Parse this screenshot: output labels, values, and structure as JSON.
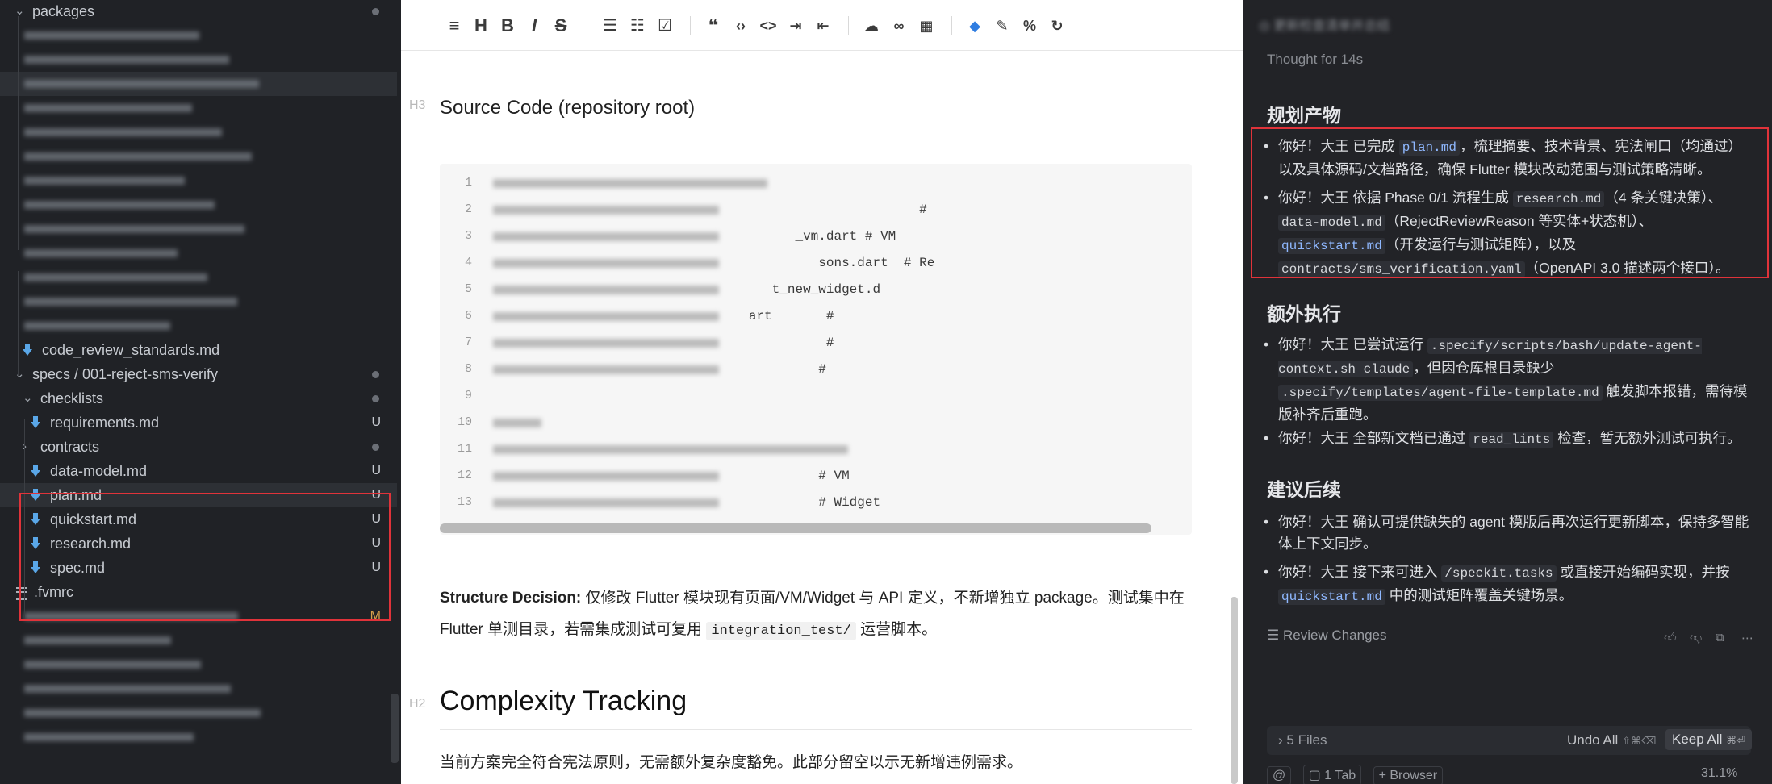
{
  "sidebar": {
    "rows": [
      {
        "label": "packages",
        "type": "folder-open",
        "dot": true
      },
      {
        "label": "",
        "type": "blurred"
      },
      {
        "label": "",
        "type": "blurred"
      },
      {
        "label": "",
        "type": "blurred",
        "selected": true
      },
      {
        "label": "",
        "type": "blurred"
      },
      {
        "label": "",
        "type": "blurred"
      },
      {
        "label": "",
        "type": "blurred"
      },
      {
        "label": "",
        "type": "blurred"
      },
      {
        "label": "",
        "type": "blurred"
      },
      {
        "label": "",
        "type": "blurred"
      },
      {
        "label": "",
        "type": "blurred"
      },
      {
        "label": "",
        "type": "blurred"
      },
      {
        "label": "",
        "type": "blurred"
      },
      {
        "label": "",
        "type": "blurred"
      },
      {
        "label": "code_review_standards.md",
        "type": "md"
      },
      {
        "label": "specs / 001-reject-sms-verify",
        "type": "folder-open",
        "dot": true
      },
      {
        "label": "checklists",
        "type": "folder-open",
        "dot": true
      },
      {
        "label": "requirements.md",
        "type": "md",
        "badge": "U"
      },
      {
        "label": "contracts",
        "type": "folder-closed",
        "dot": true
      },
      {
        "label": "data-model.md",
        "type": "md",
        "badge": "U"
      },
      {
        "label": "plan.md",
        "type": "md",
        "badge": "U",
        "selected": true
      },
      {
        "label": "quickstart.md",
        "type": "md",
        "badge": "U"
      },
      {
        "label": "research.md",
        "type": "md",
        "badge": "U"
      },
      {
        "label": "spec.md",
        "type": "md",
        "badge": "U"
      },
      {
        "label": ".fvmrc",
        "type": "lines"
      },
      {
        "label": "",
        "type": "blurred",
        "badge": "M"
      },
      {
        "label": "",
        "type": "blurred"
      },
      {
        "label": "",
        "type": "blurred"
      },
      {
        "label": "",
        "type": "blurred"
      },
      {
        "label": "",
        "type": "blurred"
      },
      {
        "label": "",
        "type": "blurred"
      }
    ]
  },
  "editor": {
    "h3_marker": "H3",
    "h3_title": "Source Code (repository root)",
    "code_lines": [
      {
        "n": "1",
        "text": ""
      },
      {
        "n": "2",
        "text": "                                                       # "
      },
      {
        "n": "3",
        "text": "                                       _vm.dart # VM "
      },
      {
        "n": "4",
        "text": "                                          sons.dart  # Re"
      },
      {
        "n": "5",
        "text": "                                    t_new_widget.d"
      },
      {
        "n": "6",
        "text": "                                 art       # "
      },
      {
        "n": "7",
        "text": "                                           # "
      },
      {
        "n": "8",
        "text": "                                          # "
      },
      {
        "n": "9",
        "text": ""
      },
      {
        "n": "10",
        "text": ""
      },
      {
        "n": "11",
        "text": ""
      },
      {
        "n": "12",
        "text": "                                          # VM "
      },
      {
        "n": "13",
        "text": "                                          # Widget "
      }
    ],
    "structure_label": "Structure Decision:",
    "structure_text": " 仅修改 Flutter 模块现有页面/VM/Widget 与 API 定义，不新增独立 package。测试集中在 Flutter 单测目录，若需集成测试可复用 ",
    "structure_code": "integration_test/",
    "structure_tail": " 运营脚本。",
    "h2_marker": "H2",
    "h2_title": "Complexity Tracking",
    "complexity_text": "当前方案完全符合宪法原则，无需额外复杂度豁免。此部分留空以示无新增违例需求。"
  },
  "chat": {
    "top_text": "更新检查清单并总结",
    "thought_label": "Thought",
    "thought_time": "for 14s",
    "section1_title": "规划产物",
    "s1_b1_a": "你好！大王 已完成 ",
    "s1_b1_code": "plan.md",
    "s1_b1_b": "，梳理摘要、技术背景、宪法闸口（均通过）以及具体源码/文档路径，确保 Flutter 模块改动范围与测试策略清晰。",
    "s1_b2_a": "你好！大王 依据 Phase 0/1 流程生成 ",
    "s1_b2_code1": "research.md",
    "s1_b2_b": "（4 条关键决策）、",
    "s1_b2_code2": "data-model.md",
    "s1_b2_c": "（RejectReviewReason 等实体+状态机）、",
    "s1_b2_code3": "quickstart.md",
    "s1_b2_d": "（开发运行与测试矩阵），以及 ",
    "s1_b2_code4": "contracts/sms_verification.yaml",
    "s1_b2_e": "（OpenAPI 3.0 描述两个接口）。",
    "section2_title": "额外执行",
    "s2_b1_a": "你好！大王 已尝试运行 ",
    "s2_b1_code": ".specify/scripts/bash/update-agent-context.sh claude",
    "s2_b1_b": "，但因仓库根目录缺少 ",
    "s2_b1_code2": ".specify/templates/agent-file-template.md",
    "s2_b1_c": " 触发脚本报错，需待模版补齐后重跑。",
    "s2_b2_a": "你好！大王 全部新文档已通过 ",
    "s2_b2_code": "read_lints",
    "s2_b2_b": " 检查，暂无额外测试可执行。",
    "section3_title": "建议后续",
    "s3_b1": "你好！大王 确认可提供缺失的 agent 模版后再次运行更新脚本，保持多智能体上下文同步。",
    "s3_b2_a": "你好！大王 接下来可进入 ",
    "s3_b2_code": "/speckit.tasks",
    "s3_b2_b": " 或直接开始编码实现，并按 ",
    "s3_b2_code2": "quickstart.md",
    "s3_b2_c": " 中的测试矩阵覆盖关键场景。",
    "review_changes": "Review Changes",
    "files_label": "5 Files",
    "undo_all": "Undo All",
    "undo_shortcut": "⇧⌘⌫",
    "keep_all": "Keep All",
    "keep_shortcut": "⌘⏎",
    "bottom_at": "@",
    "bottom_tab": "1 Tab",
    "bottom_browser": "Browser",
    "zoom": "31.1%"
  }
}
